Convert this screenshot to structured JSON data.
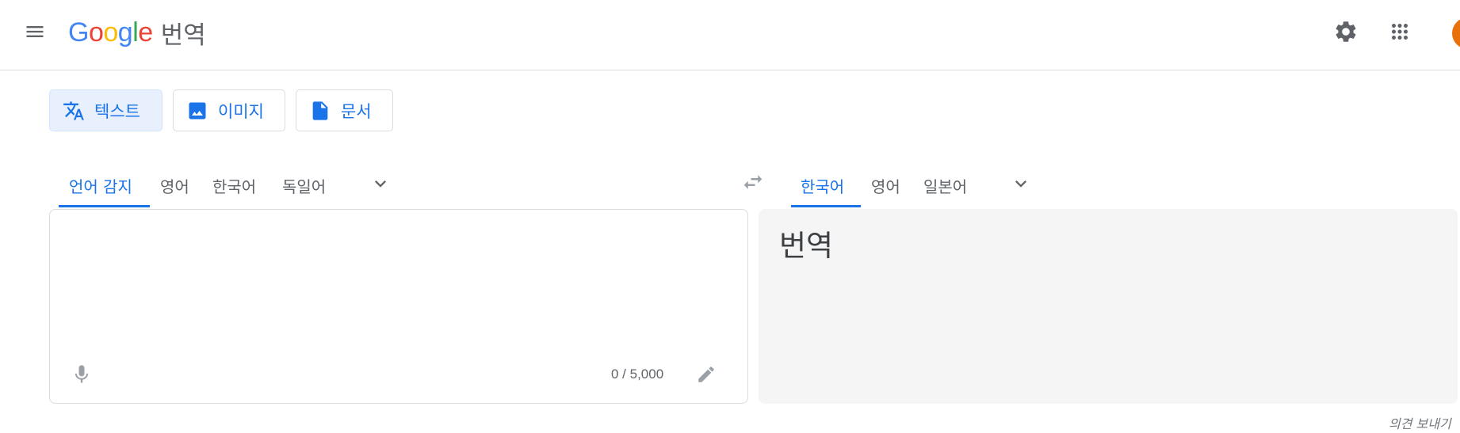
{
  "header": {
    "logo_letters": [
      "G",
      "o",
      "o",
      "g",
      "l",
      "e"
    ],
    "logo_colors": [
      "#4285F4",
      "#EA4335",
      "#FBBC05",
      "#4285F4",
      "#34A853",
      "#EA4335"
    ],
    "product_name": "번역",
    "icons": [
      "menu-icon",
      "settings-icon",
      "apps-icon",
      "avatar"
    ]
  },
  "modes": [
    {
      "label": "텍스트",
      "icon": "translate-icon",
      "active": true
    },
    {
      "label": "이미지",
      "icon": "image-icon",
      "active": false
    },
    {
      "label": "문서",
      "icon": "document-icon",
      "active": false
    }
  ],
  "source_languages": {
    "tabs": [
      {
        "label": "언어 감지",
        "active": true
      },
      {
        "label": "영어",
        "active": false
      },
      {
        "label": "한국어",
        "active": false
      },
      {
        "label": "독일어",
        "active": false
      }
    ]
  },
  "target_languages": {
    "tabs": [
      {
        "label": "한국어",
        "active": true
      },
      {
        "label": "영어",
        "active": false
      },
      {
        "label": "일본어",
        "active": false
      }
    ]
  },
  "source": {
    "value": "",
    "char_count": "0 / 5,000"
  },
  "target": {
    "placeholder": "번역"
  },
  "feedback_label": "의견 보내기",
  "colors": {
    "accent": "#1a73e8",
    "active_mode_bg": "#e8f0fe",
    "target_panel_bg": "#f5f5f5",
    "avatar": "#e8710a"
  }
}
